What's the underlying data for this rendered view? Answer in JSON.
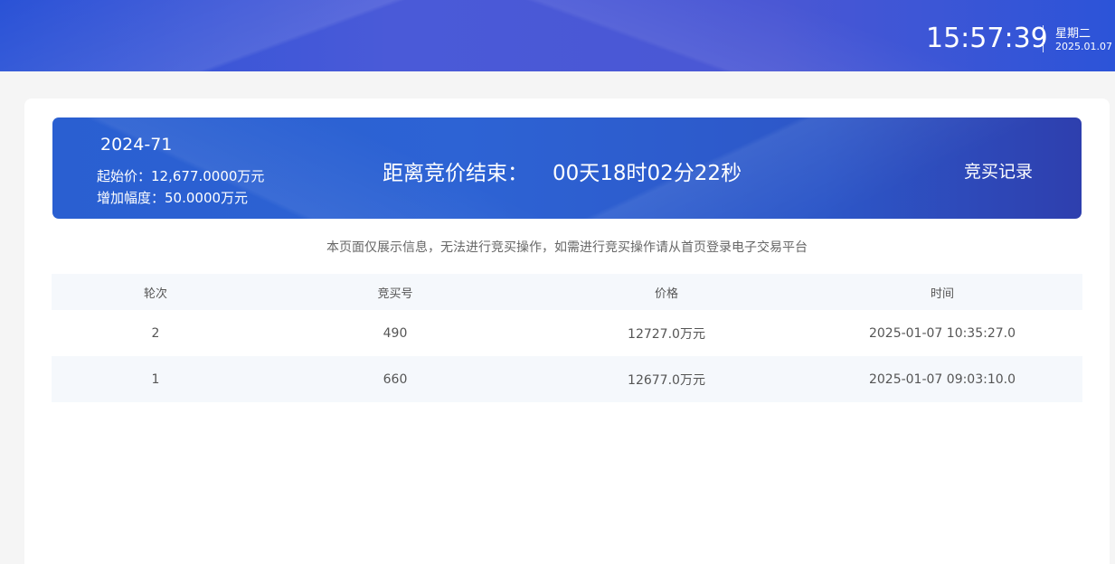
{
  "header": {
    "time": "15:57:39",
    "weekday": "星期二",
    "date": "2025.01.07"
  },
  "auction": {
    "lot_no": "2024-71",
    "start_price": "起始价：12,677.0000万元",
    "increment": "增加幅度：50.0000万元",
    "countdown_label": "距离竞价结束：",
    "countdown_value": "00天18时02分22秒",
    "bid_record_label": "竞买记录"
  },
  "notice": "本页面仅展示信息，无法进行竞买操作，如需进行竞买操作请从首页登录电子交易平台",
  "table": {
    "headers": [
      "轮次",
      "竞买号",
      "价格",
      "时间"
    ],
    "rows": [
      [
        "2",
        "490",
        "12727.0万元",
        "2025-01-07 10:35:27.0"
      ],
      [
        "1",
        "660",
        "12677.0万元",
        "2025-01-07 09:03:10.0"
      ]
    ]
  }
}
